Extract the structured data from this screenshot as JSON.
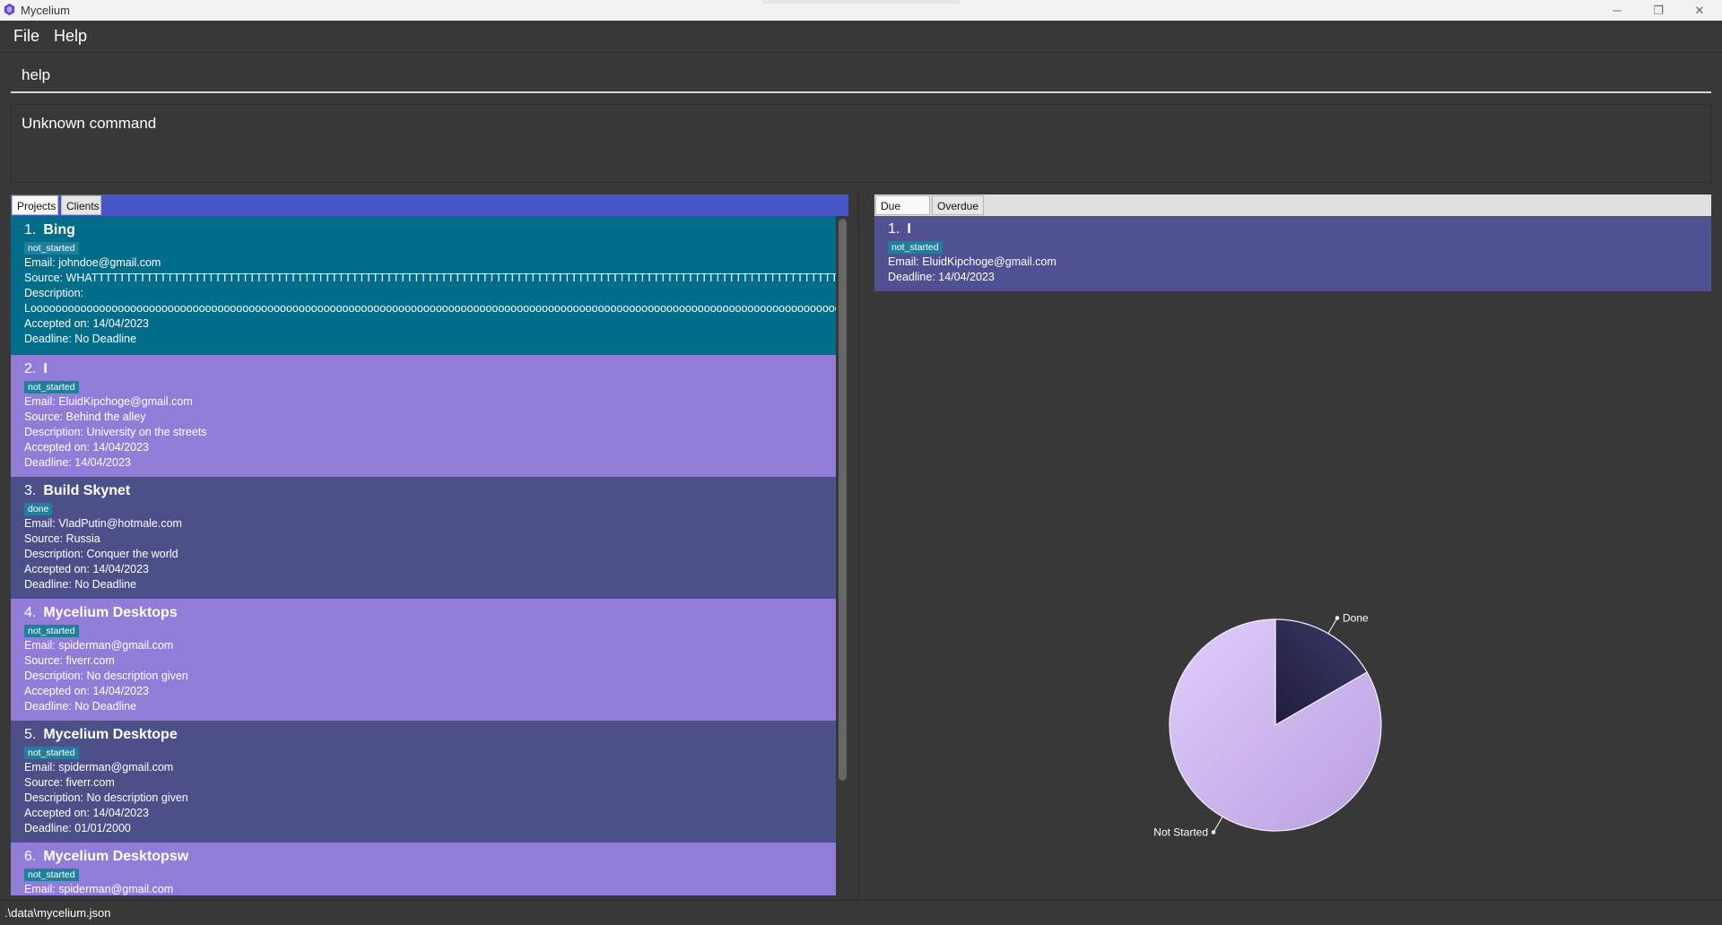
{
  "window": {
    "title": "Mycelium",
    "minimize": "─",
    "maximize": "❐",
    "close": "✕"
  },
  "menu": {
    "file": "File",
    "help": "Help"
  },
  "command": {
    "value": "help"
  },
  "result": {
    "text": "Unknown command"
  },
  "left_tabs": {
    "projects": "Projects",
    "clients": "Clients",
    "active": "Projects"
  },
  "projects": [
    {
      "num": "1.",
      "name": "Bing",
      "status": "not_started",
      "email": "Email: johndoe@gmail.com",
      "source": "Source: WHATTTTTTTTTTTTTTTTTTTTTTTTTTTTTTTTTTTTTTTTTTTTTTTTTTTTTTTTTTTTTTTTTTTTTTTTTTTTTTTTTTTTTTTTTTTTTTTTTTTTTTTTTTTTTTTTTTTTTTTTTTT",
      "description": "Description:",
      "description2": "Looooooooooooooooooooooooooooooooooooooooooooooooooooooooooooooooooooooooooooooooooooooooooooooooooooooooooooooooooooooooooooooooooooooooooooooooooooooooo",
      "accepted": "Accepted on: 14/04/2023",
      "deadline": "Deadline: No Deadline"
    },
    {
      "num": "2.",
      "name": "I",
      "status": "not_started",
      "email": "Email: EluidKipchoge@gmail.com",
      "source": "Source: Behind the alley",
      "description": "Description: University on the streets",
      "accepted": "Accepted on: 14/04/2023",
      "deadline": "Deadline: 14/04/2023"
    },
    {
      "num": "3.",
      "name": "Build Skynet",
      "status": "done",
      "email": "Email: VladPutin@hotmale.com",
      "source": "Source: Russia",
      "description": "Description: Conquer the world",
      "accepted": "Accepted on: 14/04/2023",
      "deadline": "Deadline: No Deadline"
    },
    {
      "num": "4.",
      "name": "Mycelium Desktops",
      "status": "not_started",
      "email": "Email: spiderman@gmail.com",
      "source": "Source: fiverr.com",
      "description": "Description: No description given",
      "accepted": "Accepted on: 14/04/2023",
      "deadline": "Deadline: No Deadline"
    },
    {
      "num": "5.",
      "name": "Mycelium Desktope",
      "status": "not_started",
      "email": "Email: spiderman@gmail.com",
      "source": "Source: fiverr.com",
      "description": "Description: No description given",
      "accepted": "Accepted on: 14/04/2023",
      "deadline": "Deadline: 01/01/2000"
    },
    {
      "num": "6.",
      "name": "Mycelium Desktopsw",
      "status": "not_started",
      "email": "Email: spiderman@gmail.com"
    }
  ],
  "right_tabs": {
    "due_soon": "Due soon",
    "overdue": "Overdue",
    "active": "Due soon"
  },
  "due_soon": [
    {
      "num": "1.",
      "name": "I",
      "status": "not_started",
      "email": "Email: EluidKipchoge@gmail.com",
      "deadline": "Deadline: 14/04/2023"
    }
  ],
  "chart_data": {
    "type": "pie",
    "slices": [
      {
        "label": "Done",
        "value": 1,
        "color": "#2b2a4c"
      },
      {
        "label": "Not Started",
        "value": 5,
        "color": "#c9b3ee"
      }
    ]
  },
  "status_bar": {
    "path": ".\\data\\mycelium.json"
  }
}
